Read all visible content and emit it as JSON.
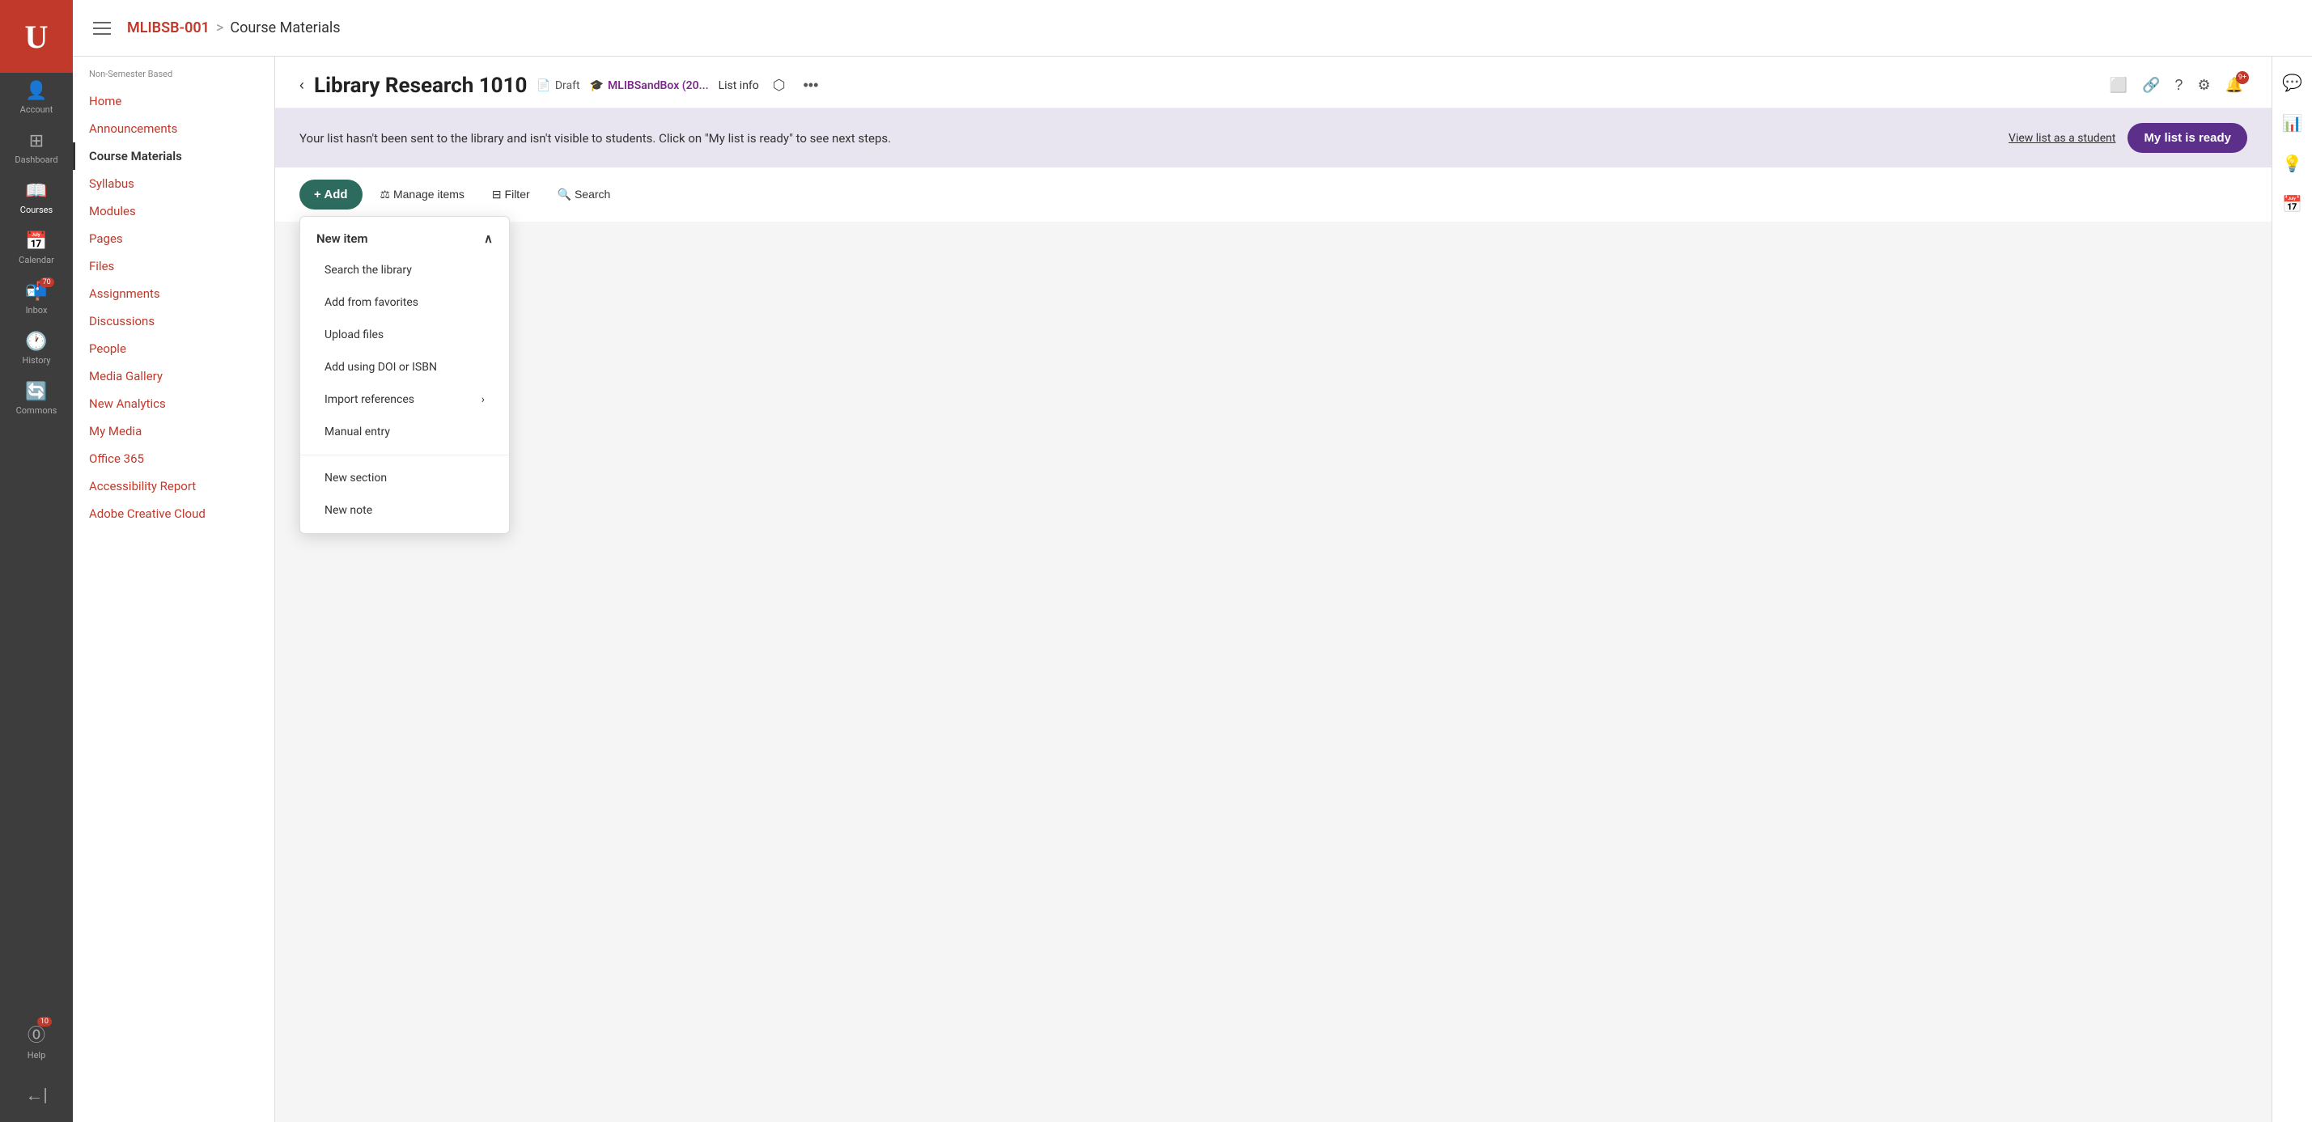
{
  "app": {
    "logo": "U",
    "logoAlt": "University of Utah"
  },
  "globalNav": {
    "items": [
      {
        "id": "account",
        "label": "Account",
        "icon": "👤",
        "badge": null
      },
      {
        "id": "dashboard",
        "label": "Dashboard",
        "icon": "⊞",
        "badge": null
      },
      {
        "id": "courses",
        "label": "Courses",
        "icon": "📖",
        "badge": null,
        "active": true
      },
      {
        "id": "calendar",
        "label": "Calendar",
        "icon": "📅",
        "badge": null
      },
      {
        "id": "inbox",
        "label": "Inbox",
        "icon": "📬",
        "badge": "70"
      },
      {
        "id": "history",
        "label": "History",
        "icon": "🕐",
        "badge": null
      },
      {
        "id": "commons",
        "label": "Commons",
        "icon": "🔄",
        "badge": null
      },
      {
        "id": "help",
        "label": "Help",
        "icon": "⓪",
        "badge": "10"
      }
    ]
  },
  "header": {
    "breadcrumb": {
      "link": "MLIBSB-001",
      "separator": ">",
      "current": "Course Materials"
    }
  },
  "courseNav": {
    "label": "Non-Semester Based",
    "items": [
      {
        "id": "home",
        "label": "Home",
        "active": false
      },
      {
        "id": "announcements",
        "label": "Announcements",
        "active": false
      },
      {
        "id": "course-materials",
        "label": "Course Materials",
        "active": true
      },
      {
        "id": "syllabus",
        "label": "Syllabus",
        "active": false
      },
      {
        "id": "modules",
        "label": "Modules",
        "active": false
      },
      {
        "id": "pages",
        "label": "Pages",
        "active": false
      },
      {
        "id": "files",
        "label": "Files",
        "active": false
      },
      {
        "id": "assignments",
        "label": "Assignments",
        "active": false
      },
      {
        "id": "discussions",
        "label": "Discussions",
        "active": false
      },
      {
        "id": "people",
        "label": "People",
        "active": false
      },
      {
        "id": "media-gallery",
        "label": "Media Gallery",
        "active": false
      },
      {
        "id": "new-analytics",
        "label": "New Analytics",
        "active": false
      },
      {
        "id": "my-media",
        "label": "My Media",
        "active": false
      },
      {
        "id": "office-365",
        "label": "Office 365",
        "active": false
      },
      {
        "id": "accessibility-report",
        "label": "Accessibility Report",
        "active": false
      },
      {
        "id": "adobe-creative-cloud",
        "label": "Adobe Creative Cloud",
        "active": false
      }
    ]
  },
  "pageHeader": {
    "backLabel": "‹",
    "title": "Library Research 1010",
    "draftLabel": "Draft",
    "sandboxLabel": "MLIBSandBox (20...",
    "listInfoLabel": "List info",
    "shareIcon": "share",
    "moreIcon": "more"
  },
  "alertBanner": {
    "text": "Your list hasn't been sent to the library and isn't visible to students. Click on \"My list is ready\" to see next steps.",
    "viewStudentLabel": "View list as a student",
    "readyBtnLabel": "My list is ready"
  },
  "toolbar": {
    "addLabel": "+ Add",
    "manageLabel": "⚖ Manage items",
    "filterLabel": "⊟ Filter",
    "searchLabel": "🔍 Search"
  },
  "dropdown": {
    "newItemLabel": "New item",
    "newItemExpanded": true,
    "items": [
      {
        "id": "search-library",
        "label": "Search the library",
        "hasArrow": false
      },
      {
        "id": "add-favorites",
        "label": "Add from favorites",
        "hasArrow": false
      },
      {
        "id": "upload-files",
        "label": "Upload files",
        "hasArrow": false
      },
      {
        "id": "add-doi-isbn",
        "label": "Add using DOI or ISBN",
        "hasArrow": false
      },
      {
        "id": "import-references",
        "label": "Import references",
        "hasArrow": true
      },
      {
        "id": "manual-entry",
        "label": "Manual entry",
        "hasArrow": false
      }
    ],
    "sectionItems": [
      {
        "id": "new-section",
        "label": "New section"
      },
      {
        "id": "new-note",
        "label": "New note"
      }
    ]
  },
  "rightPanel": {
    "icons": [
      {
        "id": "external-link",
        "icon": "⬜",
        "label": "external link"
      },
      {
        "id": "link",
        "icon": "🔗",
        "label": "link"
      },
      {
        "id": "help",
        "icon": "?",
        "label": "help"
      },
      {
        "id": "settings",
        "icon": "⚙",
        "label": "settings"
      },
      {
        "id": "notifications",
        "icon": "🔔",
        "label": "notifications",
        "badge": "9+"
      }
    ]
  }
}
